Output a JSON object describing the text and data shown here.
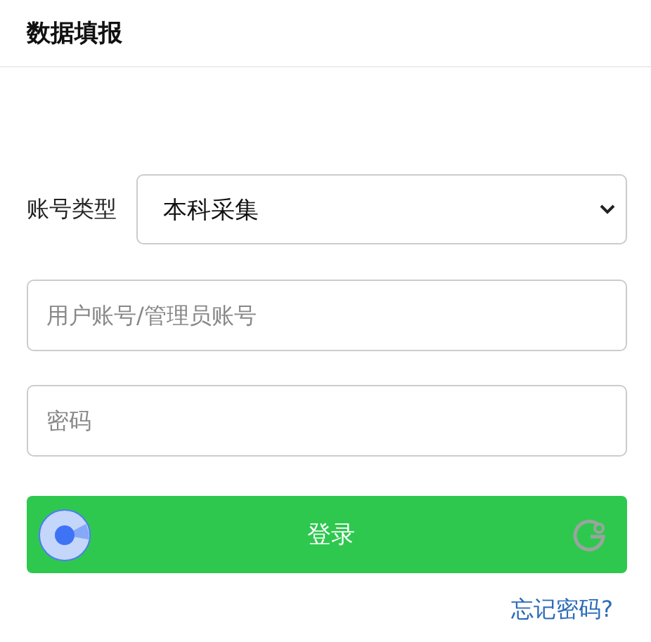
{
  "header": {
    "title": "数据填报"
  },
  "account_type": {
    "label": "账号类型",
    "value": "本科采集"
  },
  "fields": [
    {
      "placeholder": "用户账号/管理员账号"
    },
    {
      "placeholder": "密码"
    }
  ],
  "login_button": {
    "label": "登录"
  },
  "forgot_link": {
    "label": "忘记密码?"
  }
}
